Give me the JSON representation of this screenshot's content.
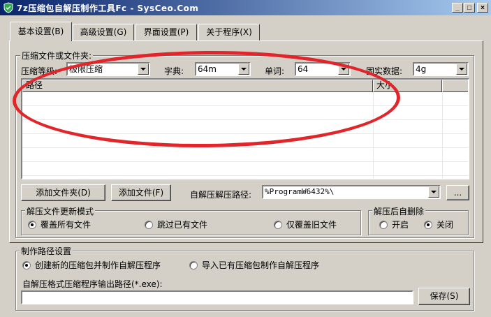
{
  "window": {
    "title": "7z压缩包自解压制作工具Fc - SysCeo.Com",
    "minimize_label": "_",
    "maximize_label": "□",
    "close_label": "×"
  },
  "tabs": [
    {
      "label": "基本设置(B)",
      "active": true
    },
    {
      "label": "高级设置(G)",
      "active": false
    },
    {
      "label": "界面设置(P)",
      "active": false
    },
    {
      "label": "关于程序(X)",
      "active": false
    }
  ],
  "compress_group": {
    "legend": "压缩文件或文件夹:",
    "level_label": "压缩等级:",
    "level_value": "极限压缩",
    "dict_label": "字典:",
    "dict_value": "64m",
    "word_label": "单词:",
    "word_value": "64",
    "solid_label": "固实数据:",
    "solid_value": "4g",
    "columns": [
      "路径",
      "大小",
      ""
    ],
    "add_folder_button": "添加文件夹(D)",
    "add_file_button": "添加文件(F)",
    "extract_path_label": "自解压解压路径:",
    "extract_path_value": "%ProgramW6432%\\",
    "browse_button": "..."
  },
  "update_mode": {
    "legend": "解压文件更新模式",
    "options": [
      {
        "label": "覆盖所有文件",
        "checked": true
      },
      {
        "label": "跳过已有文件",
        "checked": false
      },
      {
        "label": "仅覆盖旧文件",
        "checked": false
      }
    ]
  },
  "auto_delete": {
    "legend": "解压后自删除",
    "options": [
      {
        "label": "开启",
        "checked": false
      },
      {
        "label": "关闭",
        "checked": true
      }
    ]
  },
  "make_path": {
    "legend": "制作路径设置",
    "options": [
      {
        "label": "创建新的压缩包并制作自解压程序",
        "checked": true
      },
      {
        "label": "导入已有压缩包制作自解压程序",
        "checked": false
      }
    ],
    "output_label": "自解压格式压缩程序输出路径(*.exe):",
    "output_value": "",
    "save_button": "保存(S)"
  },
  "colors": {
    "annotation": "#e0262a",
    "titlebar_start": "#0a246a",
    "titlebar_end": "#a6caf0"
  }
}
